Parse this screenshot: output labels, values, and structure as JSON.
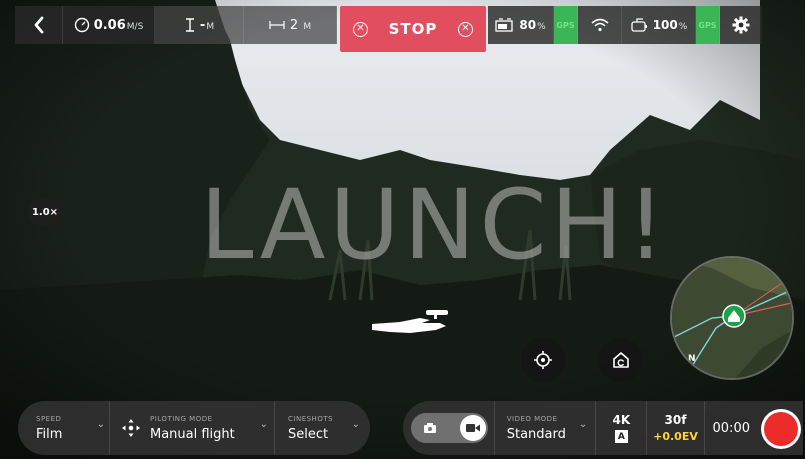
{
  "top_bar": {
    "speed_value": "0.06",
    "speed_unit": "M/S",
    "altitude_value": "-",
    "altitude_unit": "M",
    "distance_value": "2",
    "distance_unit": "M",
    "stop_label": "STOP",
    "drone_battery_value": "80",
    "drone_battery_unit": "%",
    "drone_gps_label": "GPS",
    "controller_battery_value": "100",
    "controller_battery_unit": "%",
    "controller_gps_label": "GPS"
  },
  "overlay": {
    "zoom_level": "1.0×",
    "launch_text": "LAUNCH!"
  },
  "minimap": {
    "north_label": "N"
  },
  "bottom_bar": {
    "speed_label": "SPEED",
    "speed_value": "Film",
    "piloting_label": "PILOTING MODE",
    "piloting_value": "Manual flight",
    "cineshots_label": "CINESHOTS",
    "cineshots_value": "Select",
    "video_mode_label": "VIDEO MODE",
    "video_mode_value": "Standard",
    "resolution": "4K",
    "resolution_badge": "A",
    "framerate": "30f",
    "exposure": "+0.0EV",
    "record_timer": "00:00"
  },
  "colors": {
    "stop_red": "#e04e5f",
    "gps_green": "#3bb556",
    "record_red": "#ee2b2b",
    "ev_yellow": "#ffd23c"
  }
}
